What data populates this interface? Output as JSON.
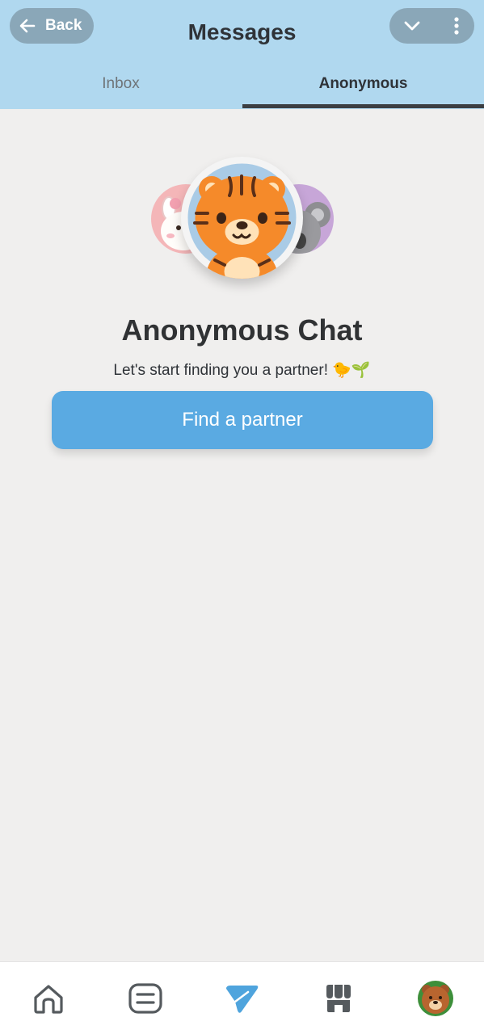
{
  "header": {
    "back_label": "Back",
    "title": "Messages"
  },
  "tabs": [
    {
      "label": "Inbox",
      "active": false
    },
    {
      "label": "Anonymous",
      "active": true
    }
  ],
  "hero": {
    "title": "Anonymous Chat",
    "subtitle": "Let's start finding you a partner! 🐤🌱",
    "button_label": "Find a partner"
  },
  "avatars": [
    "bunny-avatar",
    "tiger-avatar",
    "koala-avatar"
  ],
  "bottom_nav": [
    {
      "icon": "home-icon",
      "active": false
    },
    {
      "icon": "list-icon",
      "active": false
    },
    {
      "icon": "send-icon",
      "active": true
    },
    {
      "icon": "store-icon",
      "active": false
    },
    {
      "icon": "bear-avatar",
      "active": false
    }
  ],
  "colors": {
    "header_bg": "#b0d8ef",
    "accent": "#5aaae2",
    "page_bg": "#f0efee",
    "tiger_orange": "#f58a2a"
  }
}
